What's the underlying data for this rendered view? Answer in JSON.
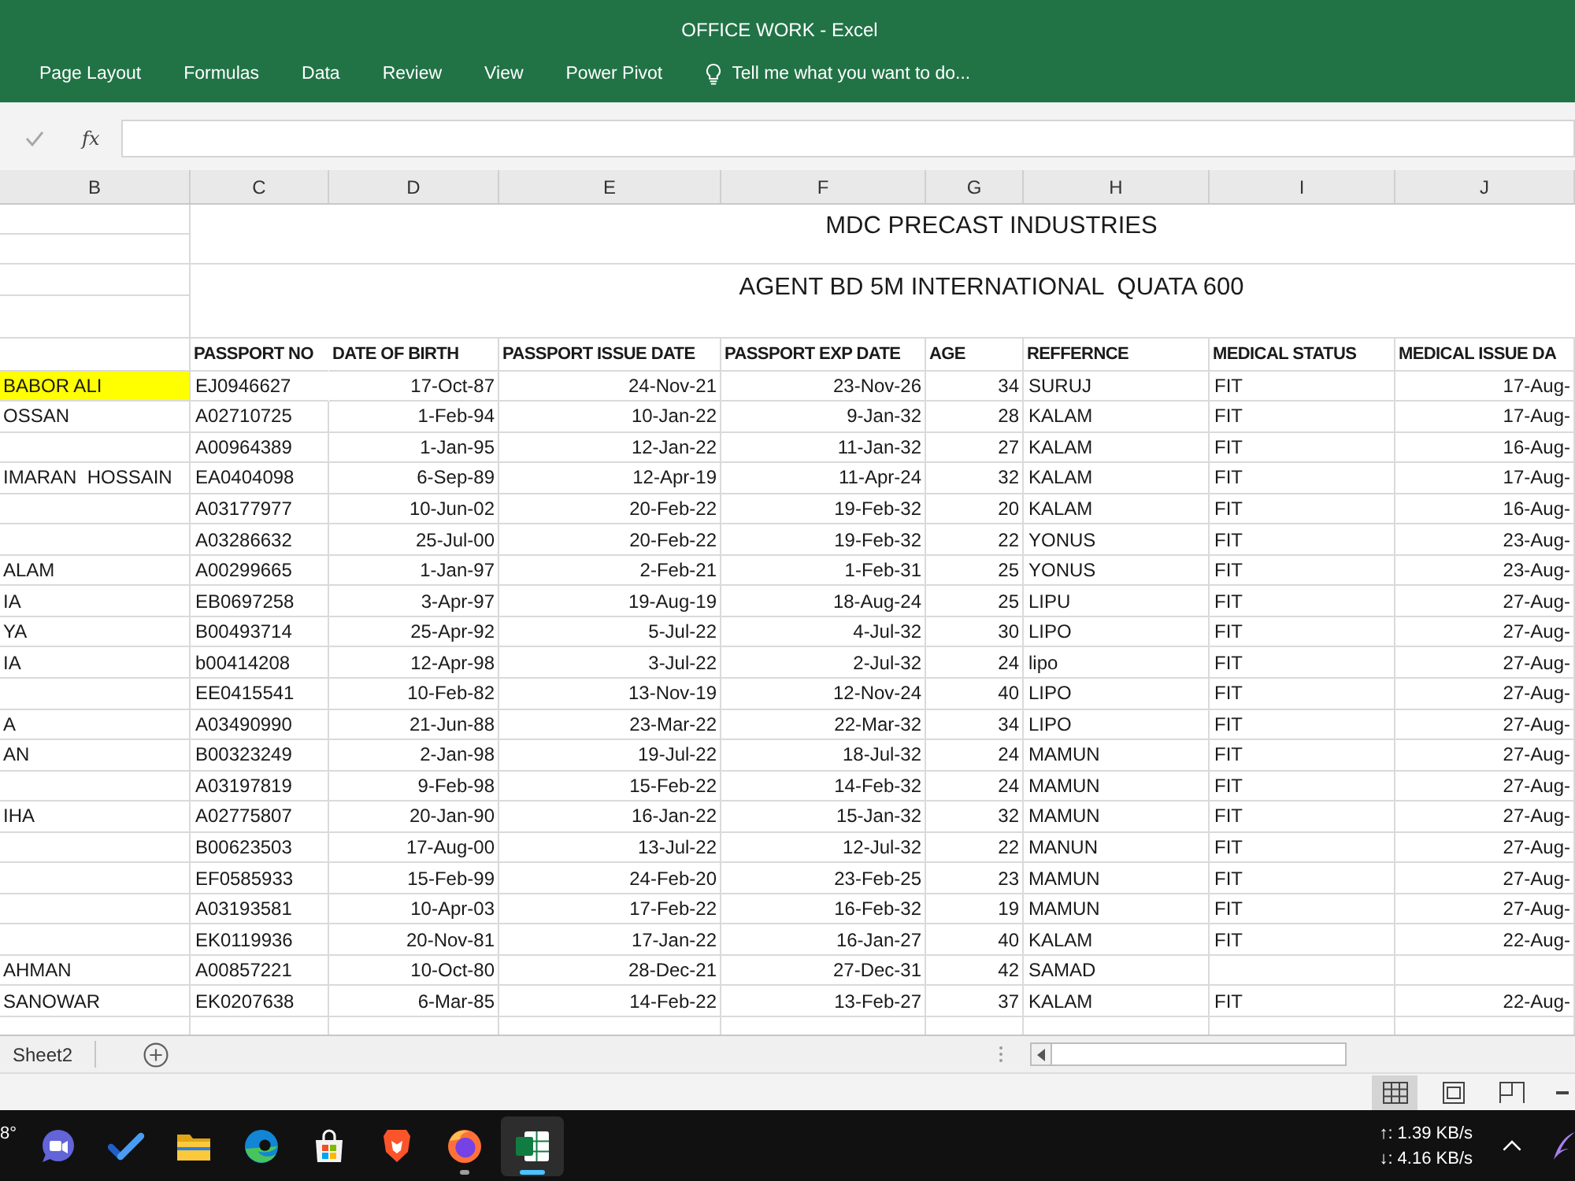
{
  "window": {
    "title": "OFFICE WORK - Excel"
  },
  "ribbon": {
    "tabs": [
      {
        "label": "Page Layout",
        "selected": false
      },
      {
        "label": "Formulas",
        "selected": false
      },
      {
        "label": "Data",
        "selected": false
      },
      {
        "label": "Review",
        "selected": false
      },
      {
        "label": "View",
        "selected": false
      },
      {
        "label": "Power Pivot",
        "selected": false
      }
    ],
    "tell_me": {
      "placeholder": "Tell me what you want to do..."
    }
  },
  "formula_bar": {
    "insert_function": "fx"
  },
  "sheet": {
    "column_letters": [
      "B",
      "C",
      "D",
      "E",
      "F",
      "G",
      "H",
      "I",
      "J"
    ],
    "titles": [
      "MDC PRECAST INDUSTRIES",
      "AGENT BD 5M INTERNATIONAL  QUATA 600"
    ],
    "columns": [
      {
        "label": "PASSPORT NO",
        "kind": "text"
      },
      {
        "label": "DATE OF BIRTH",
        "kind": "date"
      },
      {
        "label": "PASSPORT ISSUE DATE",
        "kind": "date"
      },
      {
        "label": "PASSPORT EXP DATE",
        "kind": "date"
      },
      {
        "label": "AGE",
        "kind": "number"
      },
      {
        "label": "REFFERNCE",
        "kind": "text"
      },
      {
        "label": "MEDICAL STATUS",
        "kind": "text"
      },
      {
        "label": "MEDICAL ISSUE DA",
        "kind": "date"
      }
    ],
    "rows": [
      {
        "name": "BABOR ALI",
        "highlighted": true,
        "cells": [
          "EJ0946627",
          "17-Oct-87",
          "24-Nov-21",
          "23-Nov-26",
          "34",
          "SURUJ",
          "FIT",
          "17-Aug-"
        ]
      },
      {
        "name": "OSSAN",
        "highlighted": false,
        "cells": [
          "A02710725",
          "1-Feb-94",
          "10-Jan-22",
          "9-Jan-32",
          "28",
          "KALAM",
          "FIT",
          "17-Aug-"
        ]
      },
      {
        "highlighted": false,
        "cells": [
          "A00964389",
          "1-Jan-95",
          "12-Jan-22",
          "11-Jan-32",
          "27",
          "KALAM",
          "FIT",
          "16-Aug-"
        ]
      },
      {
        "name": "IMARAN  HOSSAIN",
        "highlighted": false,
        "cells": [
          "EA0404098",
          "6-Sep-89",
          "12-Apr-19",
          "11-Apr-24",
          "32",
          "KALAM",
          "FIT",
          "17-Aug-"
        ]
      },
      {
        "highlighted": false,
        "cells": [
          "A03177977",
          "10-Jun-02",
          "20-Feb-22",
          "19-Feb-32",
          "20",
          "KALAM",
          "FIT",
          "16-Aug-"
        ]
      },
      {
        "highlighted": false,
        "cells": [
          "A03286632",
          "25-Jul-00",
          "20-Feb-22",
          "19-Feb-32",
          "22",
          "YONUS",
          "FIT",
          "23-Aug-"
        ]
      },
      {
        "name": "ALAM",
        "highlighted": false,
        "cells": [
          "A00299665",
          "1-Jan-97",
          "2-Feb-21",
          "1-Feb-31",
          "25",
          "YONUS",
          "FIT",
          "23-Aug-"
        ]
      },
      {
        "name": "IA",
        "highlighted": false,
        "cells": [
          "EB0697258",
          "3-Apr-97",
          "19-Aug-19",
          "18-Aug-24",
          "25",
          "LIPU",
          "FIT",
          "27-Aug-"
        ]
      },
      {
        "name": "YA",
        "highlighted": false,
        "cells": [
          "B00493714",
          "25-Apr-92",
          "5-Jul-22",
          "4-Jul-32",
          "30",
          "LIPO",
          "FIT",
          "27-Aug-"
        ]
      },
      {
        "name": "IA",
        "highlighted": false,
        "cells": [
          "b00414208",
          "12-Apr-98",
          "3-Jul-22",
          "2-Jul-32",
          "24",
          "lipo",
          "FIT",
          "27-Aug-"
        ]
      },
      {
        "highlighted": false,
        "cells": [
          "EE0415541",
          "10-Feb-82",
          "13-Nov-19",
          "12-Nov-24",
          "40",
          "LIPO",
          "FIT",
          "27-Aug-"
        ]
      },
      {
        "name": "A",
        "highlighted": false,
        "cells": [
          "A03490990",
          "21-Jun-88",
          "23-Mar-22",
          "22-Mar-32",
          "34",
          "LIPO",
          "FIT",
          "27-Aug-"
        ]
      },
      {
        "name": "AN",
        "highlighted": false,
        "cells": [
          "B00323249",
          "2-Jan-98",
          "19-Jul-22",
          "18-Jul-32",
          "24",
          "MAMUN",
          "FIT",
          "27-Aug-"
        ]
      },
      {
        "highlighted": false,
        "cells": [
          "A03197819",
          "9-Feb-98",
          "15-Feb-22",
          "14-Feb-32",
          "24",
          "MAMUN",
          "FIT",
          "27-Aug-"
        ]
      },
      {
        "name": "IHA",
        "highlighted": false,
        "cells": [
          "A02775807",
          "20-Jan-90",
          "16-Jan-22",
          "15-Jan-32",
          "32",
          "MAMUN",
          "FIT",
          "27-Aug-"
        ]
      },
      {
        "highlighted": false,
        "cells": [
          "B00623503",
          "17-Aug-00",
          "13-Jul-22",
          "12-Jul-32",
          "22",
          "MANUN",
          "FIT",
          "27-Aug-"
        ]
      },
      {
        "highlighted": false,
        "cells": [
          "EF0585933",
          "15-Feb-99",
          "24-Feb-20",
          "23-Feb-25",
          "23",
          "MAMUN",
          "FIT",
          "27-Aug-"
        ]
      },
      {
        "highlighted": false,
        "cells": [
          "A03193581",
          "10-Apr-03",
          "17-Feb-22",
          "16-Feb-32",
          "19",
          "MAMUN",
          "FIT",
          "27-Aug-"
        ]
      },
      {
        "highlighted": false,
        "cells": [
          "EK0119936",
          "20-Nov-81",
          "17-Jan-22",
          "16-Jan-27",
          "40",
          "KALAM",
          "FIT",
          "22-Aug-"
        ]
      },
      {
        "name": "AHMAN",
        "highlighted": false,
        "cells": [
          "A00857221",
          "10-Oct-80",
          "28-Dec-21",
          "27-Dec-31",
          "42",
          "SAMAD",
          null,
          null
        ]
      },
      {
        "name": "SANOWAR",
        "highlighted": false,
        "cells": [
          "EK0207638",
          "6-Mar-85",
          "14-Feb-22",
          "13-Feb-27",
          "37",
          "KALAM",
          "FIT",
          "22-Aug-"
        ]
      }
    ]
  },
  "sheet_tabs": [
    {
      "label": "Sheet2",
      "selected": false
    }
  ],
  "status_bar": {
    "views": [
      {
        "kind": "normal",
        "selected": true
      },
      {
        "kind": "page_layout",
        "selected": false
      },
      {
        "kind": "page_break",
        "selected": false
      }
    ]
  },
  "taskbar": {
    "weather": "8°",
    "apps": [
      {
        "kind": "chat",
        "running": false,
        "active": false
      },
      {
        "kind": "todo",
        "running": false,
        "active": false
      },
      {
        "kind": "explorer",
        "running": false,
        "active": false
      },
      {
        "kind": "edge",
        "running": false,
        "active": false
      },
      {
        "kind": "store",
        "running": false,
        "active": false
      },
      {
        "kind": "brave",
        "running": false,
        "active": false
      },
      {
        "kind": "firefox",
        "running": true,
        "active": false
      },
      {
        "kind": "excel",
        "running": true,
        "active": true
      }
    ],
    "network": {
      "upload": "↑: 1.39 KB/s",
      "download": "↓: 4.16 KB/s"
    }
  }
}
